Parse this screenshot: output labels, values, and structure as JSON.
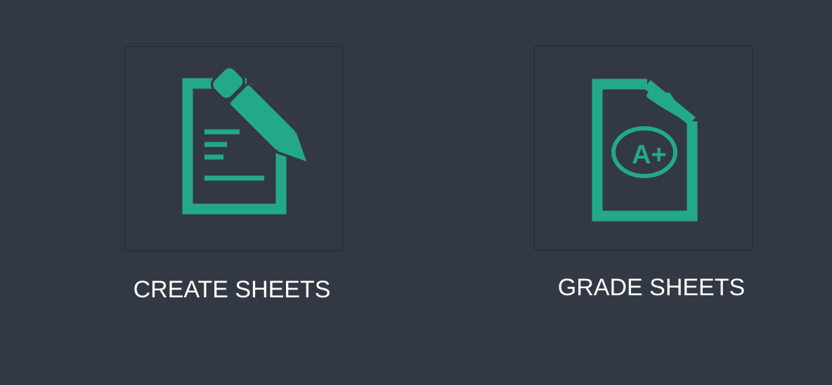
{
  "background_color": "#333944",
  "accent_color": "#23a98a",
  "tile_border_color": "#262b31",
  "cards": [
    {
      "label": "CREATE SHEETS",
      "icon": "edit-document-icon"
    },
    {
      "label": "GRADE SHEETS",
      "icon": "graded-paper-icon",
      "grade_mark": "A+"
    }
  ]
}
